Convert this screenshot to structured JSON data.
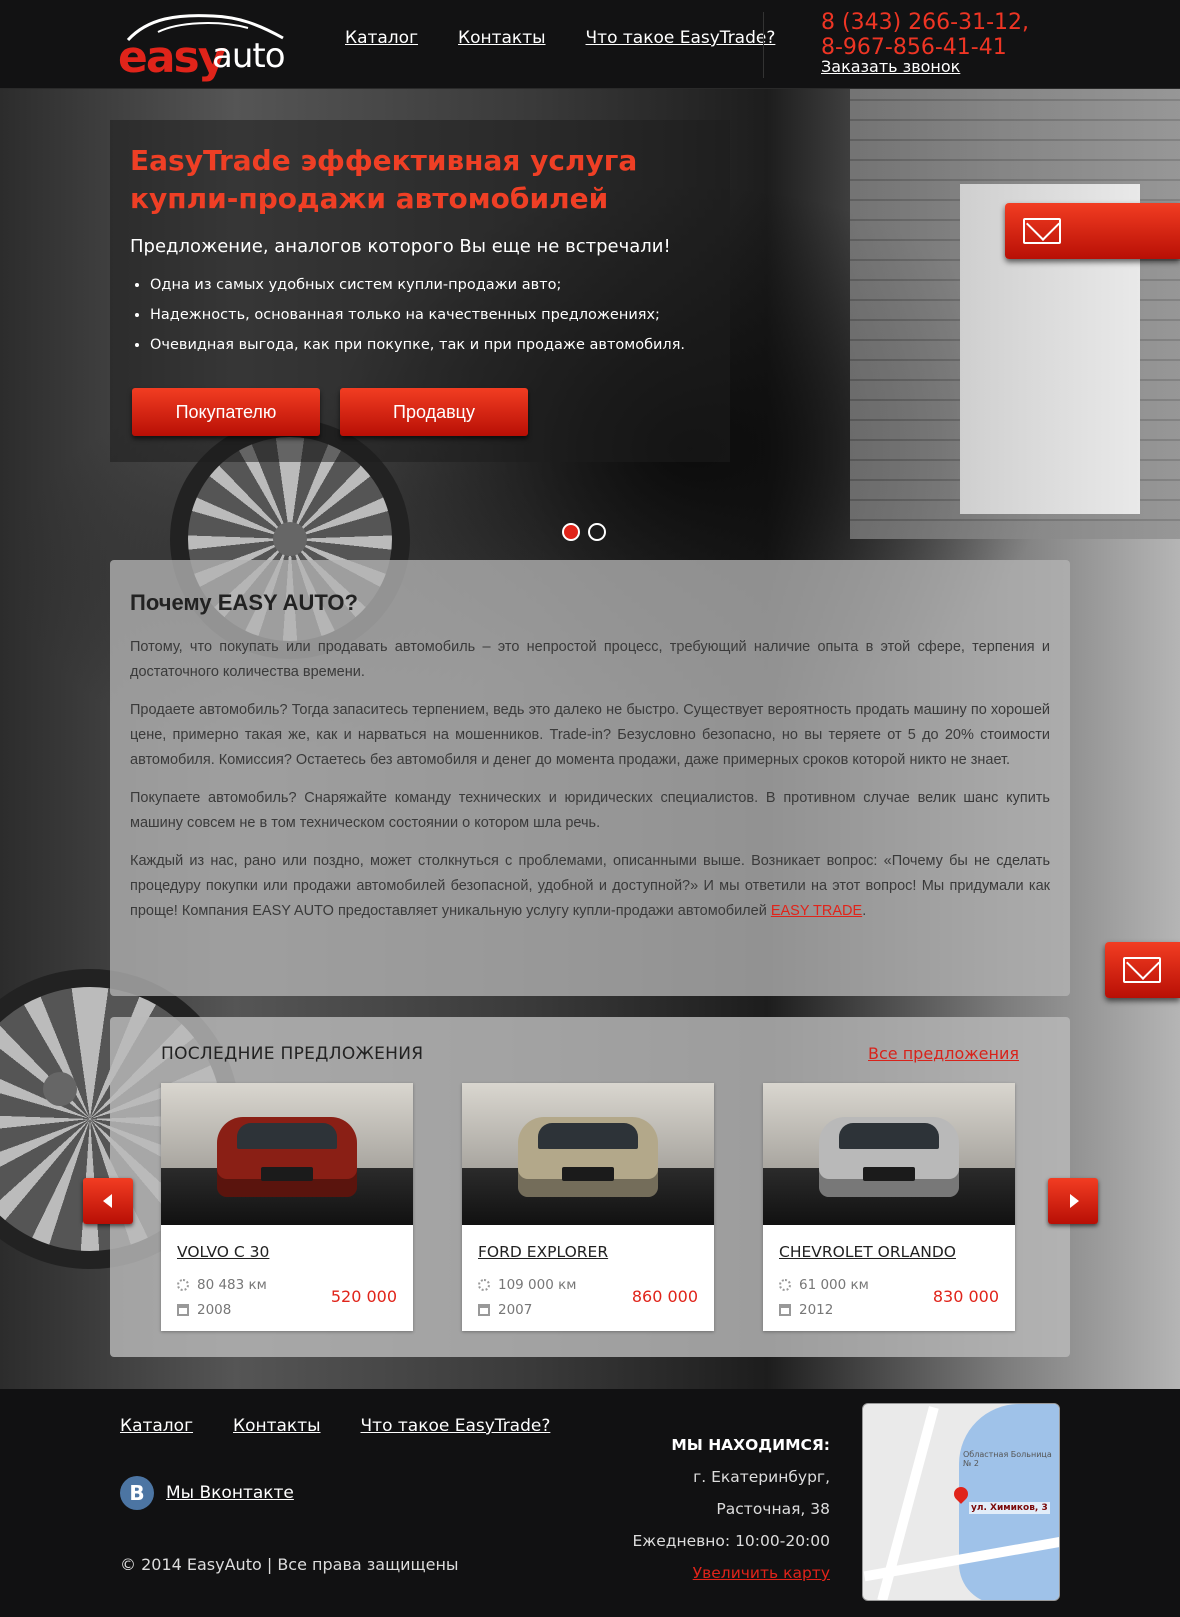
{
  "header": {
    "logo": {
      "part1": "easy",
      "part2": "auto"
    },
    "nav": [
      "Каталог",
      "Контакты",
      "Что такое EasyTrade?"
    ],
    "phones": [
      "8 (343) 266-31-12,",
      "8-967-856-41-41"
    ],
    "callback": "Заказать звонок"
  },
  "hero": {
    "title": "EasyTrade эффективная услуга купли-продажи автомобилей",
    "subtitle": "Предложение, аналогов которого Вы еще не встречали!",
    "bullets": [
      "Одна из самых удобных систем купли-продажи авто;",
      "Надежность, основанная только на качественных предложениях;",
      "Очевидная выгода, как при покупке, так и при продаже автомобиля."
    ],
    "buttons": [
      "Покупателю",
      "Продавцу"
    ],
    "slides": {
      "total": 2,
      "active": 1
    }
  },
  "icons": {
    "mail": "mail-icon",
    "prev": "arrow-left-icon",
    "next": "arrow-right-icon",
    "mileage": "speedometer-icon",
    "year": "calendar-icon",
    "vk": "vk-icon",
    "map_pin": "map-pin-icon"
  },
  "colors": {
    "accent": "#e0241a",
    "header_bg": "#121213",
    "link_red": "#d8231b",
    "vk_blue": "#4c75a3"
  },
  "why": {
    "title": "Почему EASY AUTO?",
    "paragraphs": [
      "Потому, что покупать или продавать автомобиль – это непростой процесс, требующий наличие опыта в этой сфере, терпения и достаточного количества времени.",
      "Продаете автомобиль? Тогда запаситесь терпением, ведь это далеко не быстро. Существует вероятность продать машину по хорошей цене, примерно такая же, как и нарваться на мошенников. Trade-in? Безусловно безопасно, но вы теряете от 5 до 20% стоимости автомобиля. Комиссия? Остаетесь без автомобиля и денег до момента продажи, даже примерных сроков которой никто не знает.",
      "Покупаете автомобиль? Снаряжайте команду технических и юридических специалистов. В противном случае велик шанс купить машину совсем не в том техническом состоянии о котором шла речь."
    ],
    "last_paragraph_text": "Каждый из нас, рано или поздно, может столкнуться с проблемами, описанными выше. Возникает вопрос: «Почему бы не сделать процедуру покупки или продажи автомобилей безопасной, удобной и доступной?» И мы ответили на этот вопрос! Мы придумали как проще! Компания EASY AUTO предоставляет уникальную услугу купли-продажи автомобилей ",
    "last_paragraph_link": "EASY TRADE",
    "last_paragraph_end": "."
  },
  "offers": {
    "title": "ПОСЛЕДНИЕ ПРЕДЛОЖЕНИЯ",
    "all_link": "Все предложения",
    "cars": [
      {
        "name": "VOLVO C 30",
        "mileage": "80 483 км",
        "year": "2008",
        "price": "520 000",
        "color": "#8a1f15"
      },
      {
        "name": "FORD EXPLORER",
        "mileage": "109 000 км",
        "year": "2007",
        "price": "860 000",
        "color": "#b3a88a"
      },
      {
        "name": "CHEVROLET ORLANDO",
        "mileage": "61 000 км",
        "year": "2012",
        "price": "830 000",
        "color": "#b9b9b9"
      }
    ]
  },
  "footer": {
    "nav": [
      "Каталог",
      "Контакты",
      "Что такое EasyTrade?"
    ],
    "vk": {
      "icon_letter": "В",
      "label": "Мы Вконтакте"
    },
    "copyright": "© 2014 EasyAuto | Все права защищены",
    "address": {
      "label": "МЫ НАХОДИМСЯ:",
      "lines": [
        "г. Екатеринбург,",
        "Расточная, 38",
        "Ежедневно: 10:00-20:00"
      ],
      "map_link": "Увеличить карту"
    },
    "map": {
      "pin_label": "ул. Химиков, 3",
      "place": "Областная Больница № 2"
    }
  }
}
